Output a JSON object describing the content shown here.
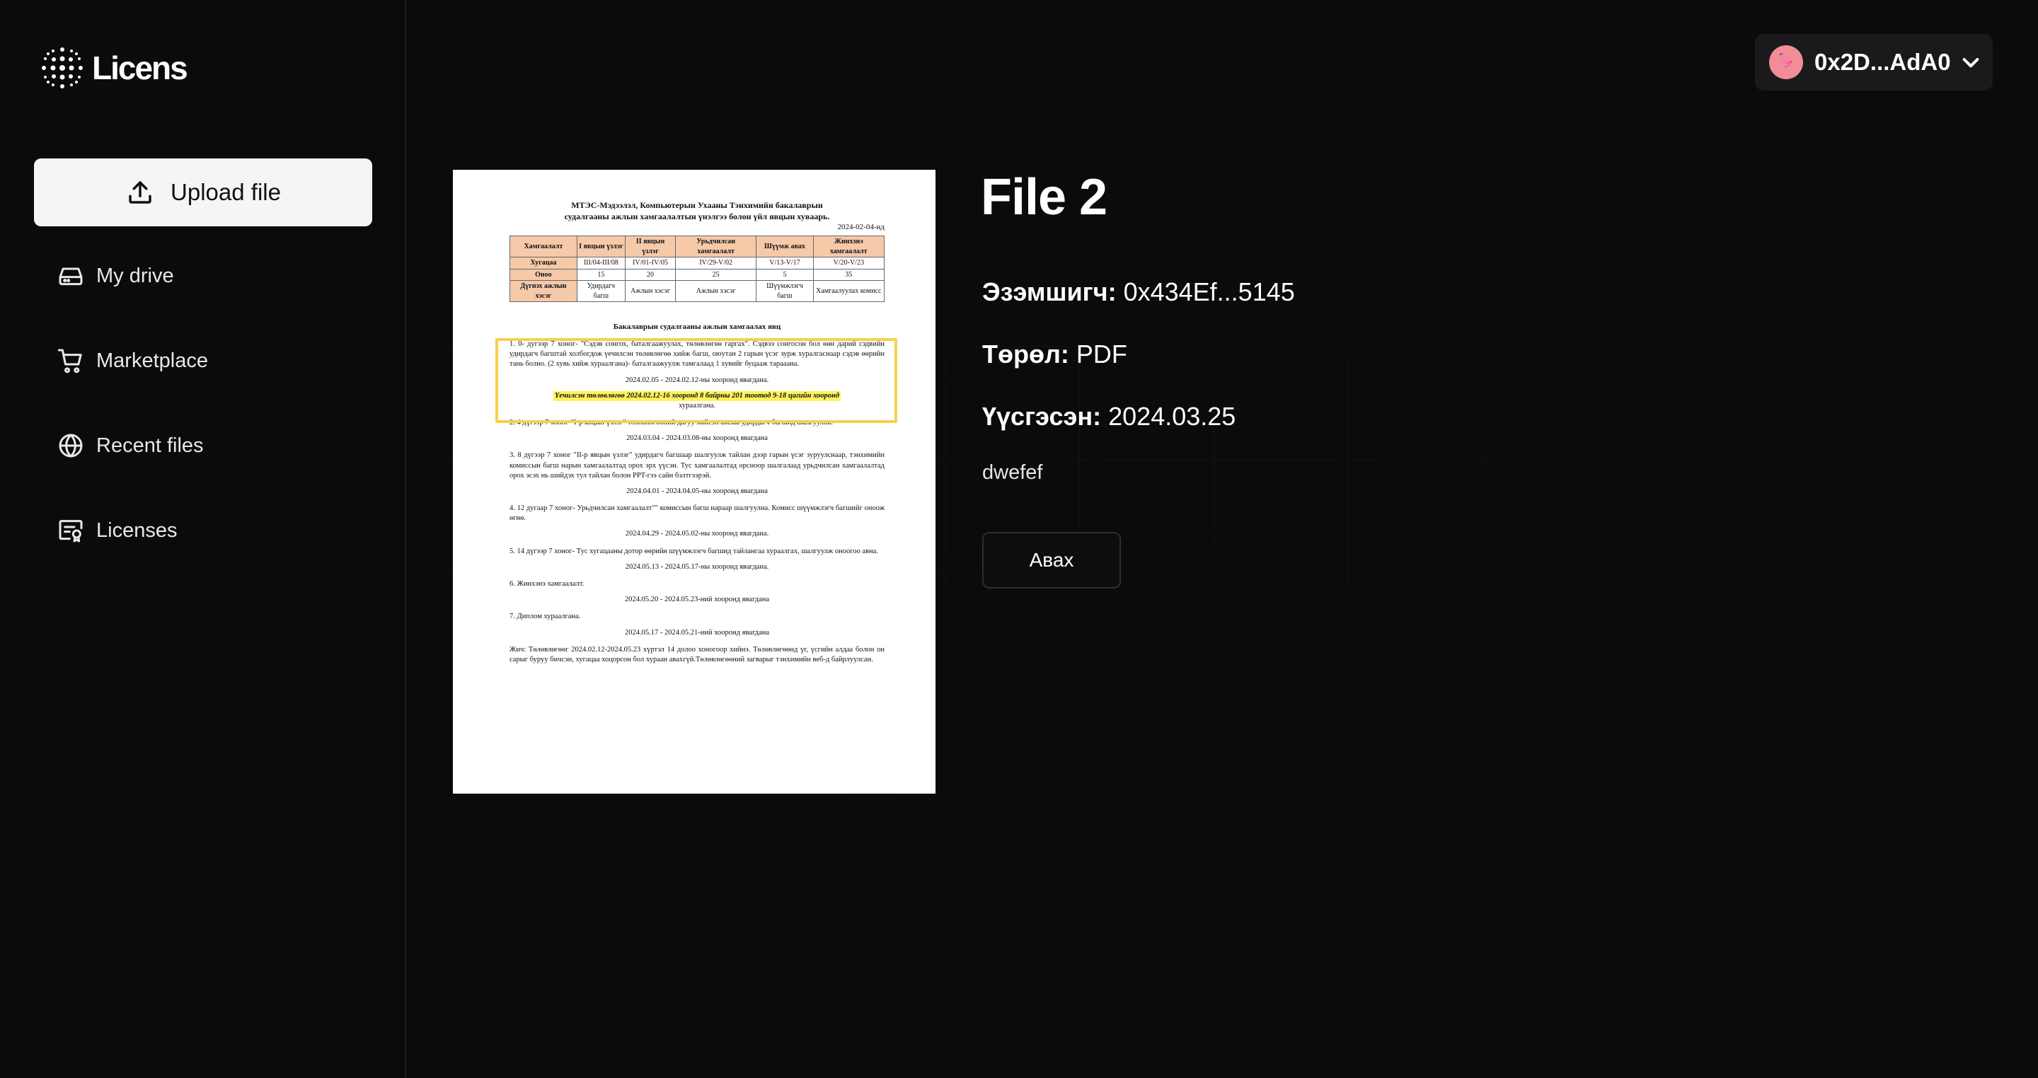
{
  "app": {
    "name": "Licens"
  },
  "sidebar": {
    "upload_label": "Upload file",
    "items": [
      {
        "label": "My drive",
        "icon": "drive-icon"
      },
      {
        "label": "Marketplace",
        "icon": "cart-icon"
      },
      {
        "label": "Recent files",
        "icon": "globe-icon"
      },
      {
        "label": "Licenses",
        "icon": "license-icon"
      }
    ]
  },
  "header": {
    "wallet_address": "0x2D...AdA0",
    "avatar_emoji": "🦩"
  },
  "file": {
    "title": "File 2",
    "owner_label": "Эзэмшигч:",
    "owner_value": "0x434Ef...5145",
    "type_label": "Төрөл:",
    "type_value": "PDF",
    "created_label": "Үүсгэсэн:",
    "created_value": "2024.03.25",
    "description": "dwefef",
    "buy_label": "Авах"
  },
  "preview": {
    "title_line1": "МТЭС-Мэдээлэл, Компьютерын Ухааны Тэнхимийн бакалаврын",
    "title_line2": "судалгааны ажлын хамгаалалтын үнэлгээ болон үйл явцын хуваарь.",
    "date": "2024-02-04-нд",
    "table_header": [
      "Хамгаалалт",
      "I явцын үзлэг",
      "II явцын үзлэг",
      "Урьдчилсан хамгаалалт",
      "Шүүмж авах",
      "Жинхэнэ хамгаалалт"
    ],
    "table_rows": [
      [
        "Хугацаа",
        "III/04-III/08",
        "IV/01-IV/05",
        "IV/29-V/02",
        "V/13-V/17",
        "V/20-V/23"
      ],
      [
        "Оноо",
        "15",
        "20",
        "25",
        "5",
        "35"
      ],
      [
        "Дүгнэх ажлын хэсэг",
        "Удирдагч багш",
        "Ажлын хэсэг",
        "Ажлын хэсэг",
        "Шүүмжлэгч багш",
        "Хамгаалуулах комисс"
      ]
    ],
    "subtitle": "Бакалаврын судалгааны ажлын хамгаалах явц",
    "p1": "1.   0- дугээр 7 хоног- \"Сэдэв сонгох, баталгаажуулах, төлөвлөгөө гаргах\". Сэдвээ сонгосон бол өөн дарий сэдвийн удирдагч багштай холбогдож үечилсэн төлөвлөгөө хийж багш, оюутан 2 гарын үсэг зурж хуралгаснаар сэдэв өөрийн тань болно. (2 хувь хийж хураалгана)- баталгаажуулж тамгалаад 1 хувийг буцааж тарааана.",
    "d1": "2024.02.05 - 2024.02.12-ны хооронд явагдана.",
    "hl": "Үечилсэн төлөвлөгөө 2024.02.12-16 хооронд 8 байрны 201 тоотод 9-18 цагийн хооронд",
    "hl_tail": "хураалгана.",
    "p2": "2.   4 дүгээр 7 хоног-\"I-р явцын үзлэг\" төлөвлөгөөний дагуу хийсэн ажлаа удирдагч багшид шалгуулна.",
    "d2": "2024.03.04 - 2024.03.08-ны хооронд явагдана",
    "p3": "3.   8 дүгээр 7 хоног \"II-р явцын үзлэг\" удирдагч багшаар шалгуулж тайлан дээр гарын үсэг зуруулснаар, тэнхимийн комиссын багш нарын хамгаалалтад орох эрх үүсэн. Тус хамгаалалтад орсноор шалгалаад урьдчилсан хамгаалалтад орох эсэх нь шийдэх тул тайлан болон PPT-гээ сайн бэлтгээрэй.",
    "d3": "2024.04.01 - 2024.04.05-ны хооронд явагдана",
    "p4": "4.   12 дугаар 7 хоног- Урьдчилсан хамгаалалт\"\" комиссын багш нараар шалгуулна. Комисс шүүмжлэгч багшийг оноож өгнө.",
    "d4": "2024.04.29 - 2024.05.02-ны хооронд явагдана.",
    "p5": "5.   14 дүгээр 7 хоног- Тус хугацааны дотор өөрийн шүүмжлэгч багшид тайлангаа хураалгах, шалгуулж оноогоо авна.",
    "d5": "2024.05.13 - 2024.05.17-ны хооронд явагдана.",
    "p6": "6.   Жинхэнэ хамгаалалт.",
    "d6": "2024.05.20 - 2024.05.23-ний хооронд явагдана",
    "p7": "7.   Диплом хураалгана.",
    "d7": "2024.05.17 - 2024.05.21-ний хооронд явагдана",
    "note": "Жич: Төлөвлөгөөг 2024.02.12-2024.05.23 хүртэл 14 долоо хоногоор хийнэ. Төлөвлөгөөнд үг, үсгийн алдаа болон он сарыг буруу бичсэн, хугацаа хоцорсон бол хураан авахгүй.Төлөвлөгөөний загварыг тэнхимийн веб-д байрлуулсан."
  },
  "colors": {
    "accent_highlight": "#f7d14b",
    "avatar_bg": "#f08d96"
  }
}
